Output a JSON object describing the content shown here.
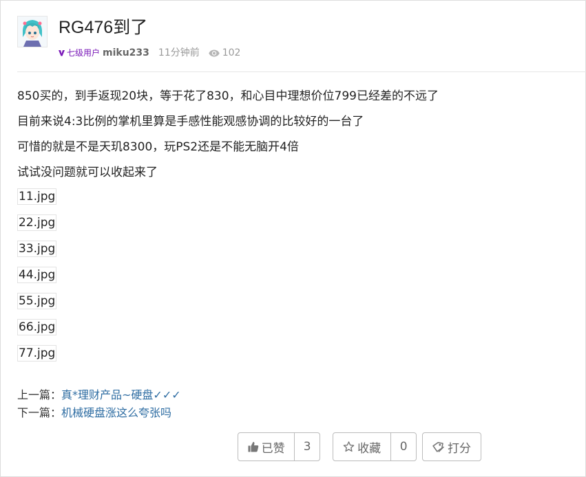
{
  "post": {
    "title": "RG476到了",
    "author": {
      "level_badge": "七级用户",
      "username": "miku233"
    },
    "time": "11分钟前",
    "views": "102"
  },
  "content": {
    "paragraphs": [
      "850买的，到手返现20块，等于花了830，和心目中理想价位799已经差的不远了",
      "目前来说4:3比例的掌机里算是手感性能观感协调的比较好的一台了",
      "可惜的就是不是天玑8300，玩PS2还是不能无脑开4倍",
      "试试没问题就可以收起来了"
    ],
    "attachments": [
      "11.jpg",
      "22.jpg",
      "33.jpg",
      "44.jpg",
      "55.jpg",
      "66.jpg",
      "77.jpg"
    ]
  },
  "nav": {
    "prev_label": "上一篇：",
    "prev_title": "真*理财产品~硬盘✓✓✓",
    "next_label": "下一篇：",
    "next_title": "机械硬盘涨这么夸张吗"
  },
  "actions": {
    "like_label": "已赞",
    "like_count": "3",
    "fav_label": "收藏",
    "fav_count": "0",
    "rate_label": "打分"
  },
  "colors": {
    "link": "#2d6ca2",
    "badge": "#7a19b8",
    "muted": "#999999"
  },
  "icons": {
    "level": "level-badge-icon",
    "views": "eye-icon",
    "like": "thumbs-up-icon",
    "favorite": "star-icon",
    "rate": "tag-icon"
  }
}
